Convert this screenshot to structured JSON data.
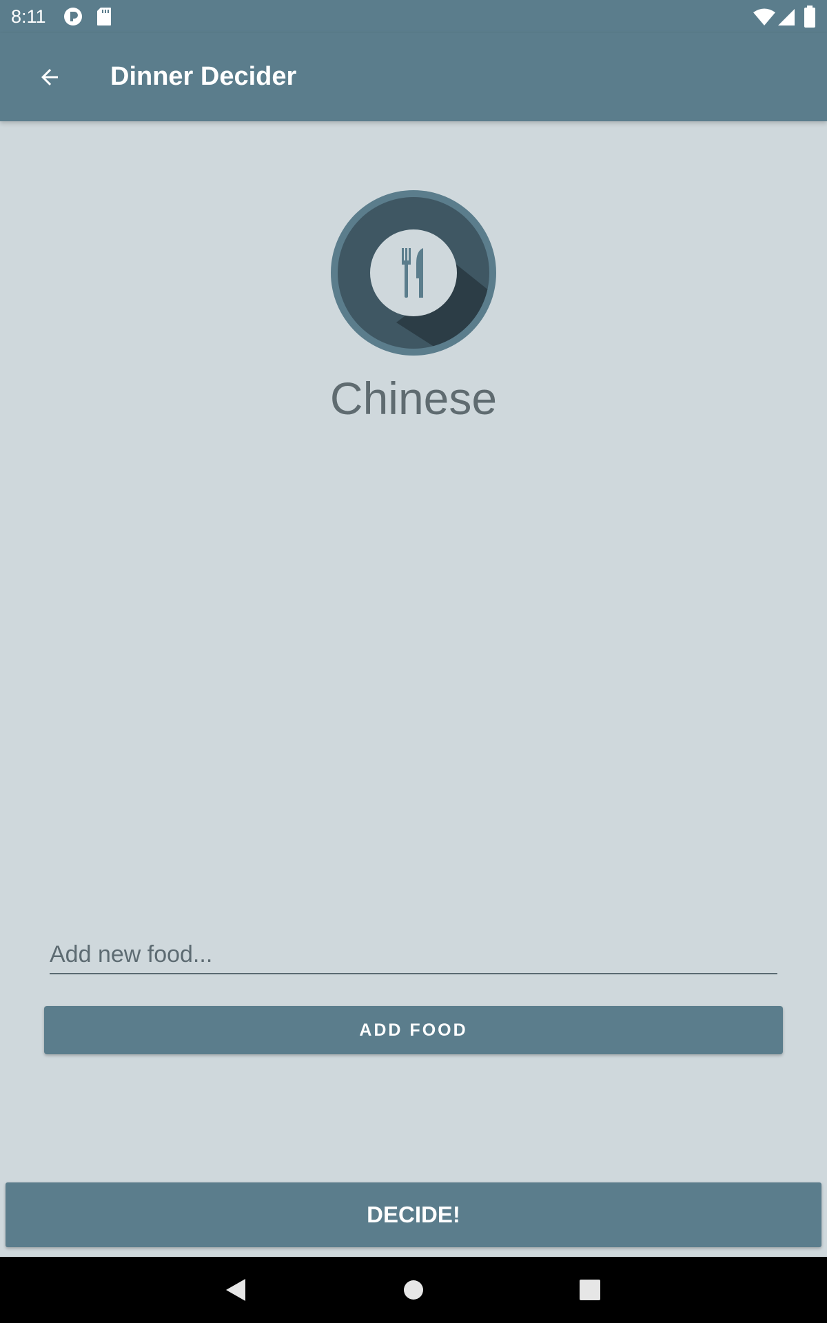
{
  "status_bar": {
    "time": "8:11",
    "icons": [
      "circle-app-icon",
      "sd-card-icon",
      "wifi-icon",
      "signal-icon",
      "battery-icon"
    ]
  },
  "app_bar": {
    "back_icon": "arrow-back-icon",
    "title": "Dinner Decider"
  },
  "main": {
    "logo_icon": "plate-cutlery-icon",
    "selected_food": "Chinese",
    "new_food_input": {
      "value": "",
      "placeholder": "Add new food..."
    },
    "add_button_label": "ADD FOOD",
    "decide_button_label": "DECIDE!"
  },
  "nav_bar": {
    "icons": [
      "nav-back-icon",
      "nav-home-icon",
      "nav-recents-icon"
    ]
  },
  "colors": {
    "primary": "#5b7d8c",
    "background": "#cfd8dc",
    "logo_dark": "#3f5763",
    "text_secondary": "#5f6b70"
  }
}
